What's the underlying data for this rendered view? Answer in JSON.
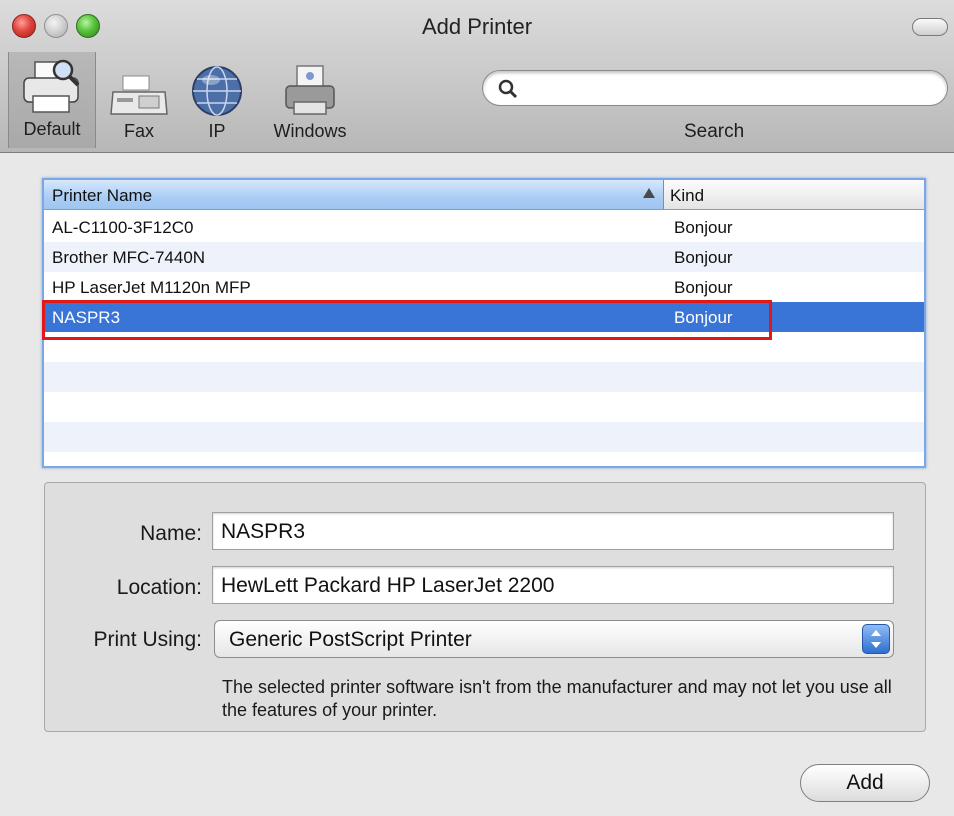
{
  "window": {
    "title": "Add Printer"
  },
  "toolbar": {
    "items": [
      {
        "label": "Default",
        "icon": "printer-icon"
      },
      {
        "label": "Fax",
        "icon": "fax-icon"
      },
      {
        "label": "IP",
        "icon": "globe-icon"
      },
      {
        "label": "Windows",
        "icon": "windows-printer-icon"
      }
    ],
    "search": {
      "label": "Search",
      "placeholder": "",
      "value": ""
    }
  },
  "printer_list": {
    "columns": [
      "Printer Name",
      "Kind"
    ],
    "sorted_column": "Printer Name",
    "rows": [
      {
        "name": "AL-C1100-3F12C0",
        "kind": "Bonjour"
      },
      {
        "name": "Brother MFC-7440N",
        "kind": "Bonjour"
      },
      {
        "name": "HP LaserJet M1120n MFP",
        "kind": "Bonjour"
      },
      {
        "name": "NASPR3",
        "kind": "Bonjour",
        "selected": true
      }
    ]
  },
  "details": {
    "name_label": "Name:",
    "name_value": "NASPR3",
    "location_label": "Location:",
    "location_value": "HewLett Packard HP LaserJet 2200",
    "print_using_label": "Print Using:",
    "print_using_value": "Generic PostScript Printer",
    "note": "The selected printer software isn't from the manufacturer and may not let you use all the features of your printer."
  },
  "buttons": {
    "add": "Add"
  },
  "colors": {
    "selection": "#3875d7",
    "highlight_box": "#e01818",
    "list_focus": "#7ba7e4"
  }
}
